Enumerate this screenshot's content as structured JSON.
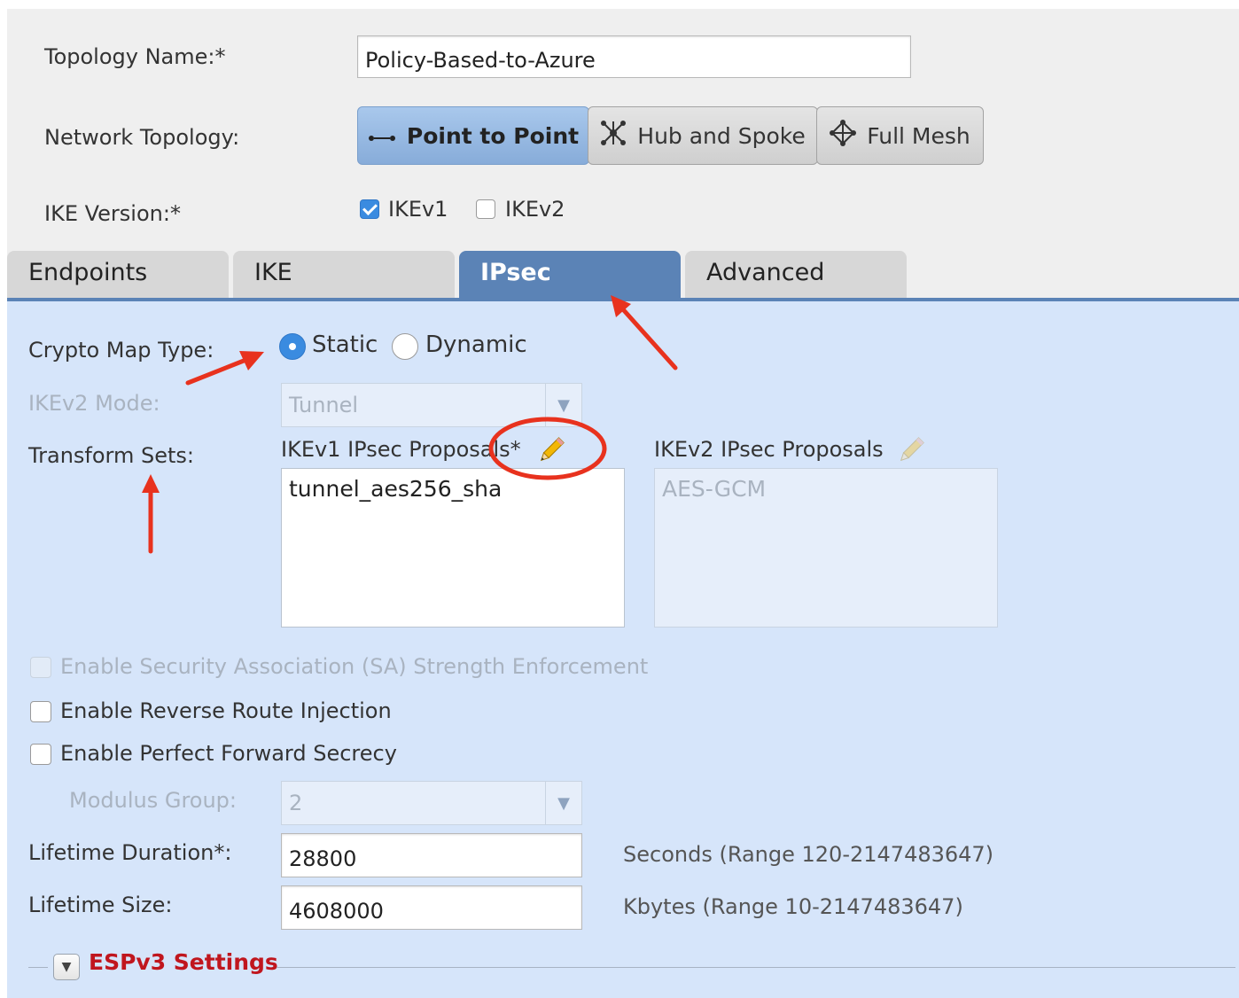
{
  "form": {
    "topology_name_label": "Topology Name:*",
    "topology_name_value": "Policy-Based-to-Azure",
    "network_topology_label": "Network Topology:",
    "topology_options": [
      {
        "label": "Point to Point",
        "icon": "point-to-point-icon",
        "active": true
      },
      {
        "label": "Hub and Spoke",
        "icon": "hub-spoke-icon",
        "active": false
      },
      {
        "label": "Full Mesh",
        "icon": "full-mesh-icon",
        "active": false
      }
    ],
    "ike_version_label": "IKE Version:*",
    "ike_versions": [
      {
        "label": "IKEv1",
        "checked": true
      },
      {
        "label": "IKEv2",
        "checked": false
      }
    ]
  },
  "tabs": [
    {
      "label": "Endpoints",
      "active": false
    },
    {
      "label": "IKE",
      "active": false
    },
    {
      "label": "IPsec",
      "active": true
    },
    {
      "label": "Advanced",
      "active": false
    }
  ],
  "ipsec": {
    "crypto_map_type_label": "Crypto Map Type:",
    "crypto_map_options": [
      {
        "label": "Static",
        "checked": true
      },
      {
        "label": "Dynamic",
        "checked": false
      }
    ],
    "ikev2_mode_label": "IKEv2 Mode:",
    "ikev2_mode_value": "Tunnel",
    "transform_sets_label": "Transform Sets:",
    "ikev1_proposals_label": "IKEv1 IPsec Proposals*",
    "ikev1_proposals": [
      "tunnel_aes256_sha"
    ],
    "ikev2_proposals_label": "IKEv2 IPsec Proposals",
    "ikev2_proposals": [
      "AES-GCM"
    ],
    "sa_strength_label": "Enable Security Association (SA) Strength Enforcement",
    "reverse_route_label": "Enable Reverse Route Injection",
    "pfs_label": "Enable Perfect Forward Secrecy",
    "modulus_group_label": "Modulus Group:",
    "modulus_group_value": "2",
    "lifetime_duration_label": "Lifetime Duration*:",
    "lifetime_duration_value": "28800",
    "lifetime_duration_unit": "Seconds (Range 120-2147483647)",
    "lifetime_size_label": "Lifetime Size:",
    "lifetime_size_value": "4608000",
    "lifetime_size_unit": "Kbytes (Range 10-2147483647)",
    "espv3_label": "ESPv3 Settings"
  },
  "colors": {
    "accent_tab": "#5b83b6",
    "panel_bg": "#d6e5fa",
    "annotation_red": "#e8321e",
    "espv3_red": "#c0161e"
  }
}
